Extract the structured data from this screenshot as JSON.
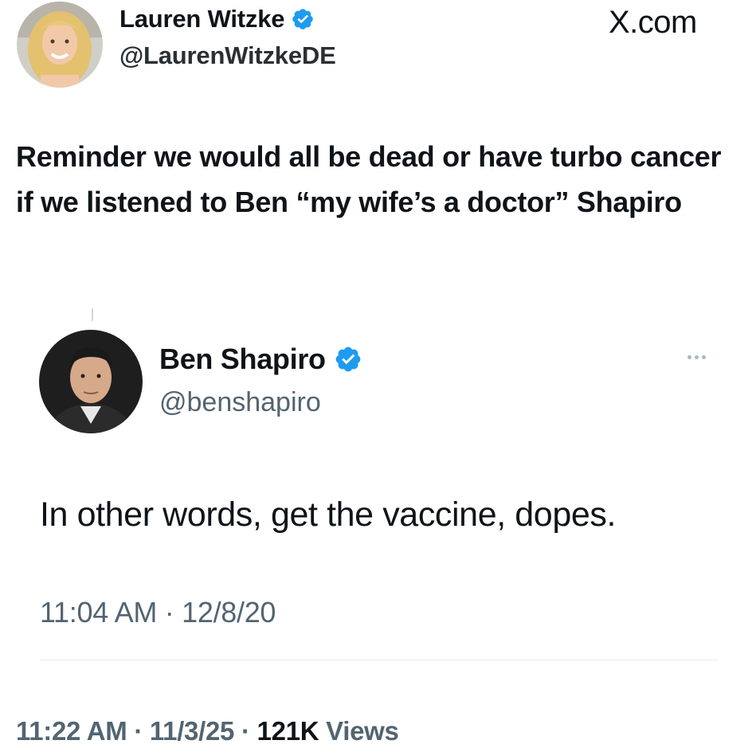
{
  "author": {
    "name": "Lauren Witzke",
    "handle": "@LaurenWitzkeDE",
    "verified": true
  },
  "site_label": "X.com",
  "tweet": {
    "text": "Reminder we would all be dead or have turbo cancer if we listened to Ben “my wife’s a doctor” Shapiro",
    "timestamp": "11:22 AM",
    "date": "11/3/25",
    "views_count": "121K",
    "views_label": "Views",
    "separator": "·"
  },
  "quoted_tweet": {
    "name": "Ben Shapiro",
    "handle": "@benshapiro",
    "verified": true,
    "text": "In other words, get the vaccine, dopes.",
    "timestamp": "11:04 AM · 12/8/20"
  },
  "icons": {
    "verified": "verified-badge-icon",
    "more": "more-options-icon"
  },
  "colors": {
    "verified_blue": "#1d9bf0",
    "text_primary": "#0f1419",
    "text_secondary": "#536471"
  }
}
